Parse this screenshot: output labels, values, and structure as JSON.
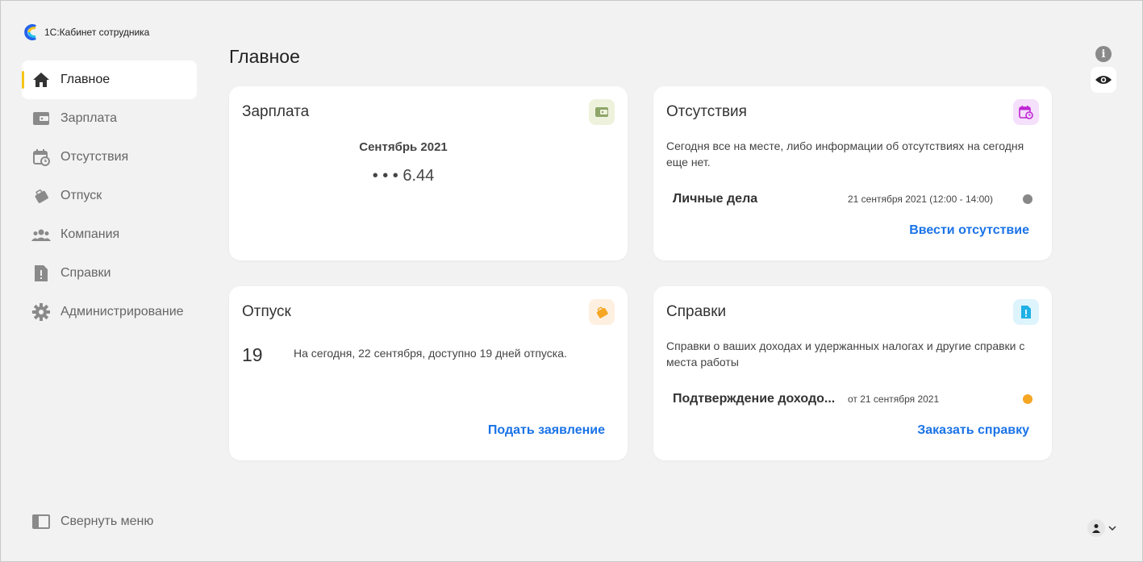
{
  "app": {
    "title": "1С:Кабинет сотрудника"
  },
  "nav": {
    "items": [
      {
        "label": "Главное",
        "icon": "home-icon",
        "active": true
      },
      {
        "label": "Зарплата",
        "icon": "wallet-icon"
      },
      {
        "label": "Отсутствия",
        "icon": "calendar-clock-icon"
      },
      {
        "label": "Отпуск",
        "icon": "suitcase-icon"
      },
      {
        "label": "Компания",
        "icon": "people-icon"
      },
      {
        "label": "Справки",
        "icon": "document-alert-icon"
      },
      {
        "label": "Администрирование",
        "icon": "gear-icon"
      }
    ],
    "collapse_label": "Свернуть меню"
  },
  "page": {
    "title": "Главное"
  },
  "cards": {
    "salary": {
      "title": "Зарплата",
      "period": "Сентябрь 2021",
      "amount": "• • • 6.44"
    },
    "absences": {
      "title": "Отсутствия",
      "text": "Сегодня все на месте, либо информации об отсутствиях на сегодня еще нет.",
      "item_title": "Личные дела",
      "item_date": "21 сентября 2021 (12:00 - 14:00)",
      "link": "Ввести отсутствие"
    },
    "vacation": {
      "title": "Отпуск",
      "days": "19",
      "text": "На сегодня, 22 сентября, доступно 19 дней отпуска.",
      "link": "Подать заявление"
    },
    "certificates": {
      "title": "Справки",
      "text": "Справки о ваших доходах и удержанных налогах и другие справки с места работы",
      "item_title": "Подтверждение доходо...",
      "item_date": "от 21 сентября 2021",
      "link": "Заказать справку"
    }
  },
  "colors": {
    "accent": "#f5c518",
    "link": "#1a73e8",
    "salary_badge": "#eef2dc",
    "absences_badge": "#f4e0fb",
    "vacation_badge": "#fdf0e0",
    "certificates_badge": "#def4fd",
    "status_gray": "#888888",
    "status_orange": "#f5a623"
  }
}
